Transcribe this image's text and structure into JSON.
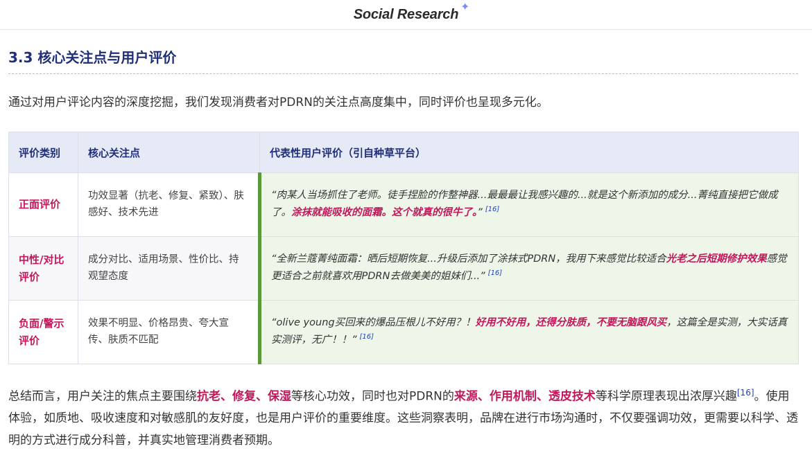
{
  "brand": {
    "name": "Social Research",
    "star": "✦"
  },
  "section": {
    "title": "3.3 核心关注点与用户评价"
  },
  "intro": "通过对用户评论内容的深度挖掘，我们发现消费者对PDRN的关注点高度集中，同时评价也呈现多元化。",
  "table": {
    "headers": [
      "评价类别",
      "核心关注点",
      "代表性用户评价（引自种草平台）"
    ],
    "rows": [
      {
        "category": "正面评价",
        "focus": "功效显著（抗老、修复、紧致）、肤感好、技术先进",
        "quote_plain": "“肉某人当场抓住了老师。徒手捏脸的作整神器...最最最让我感兴趣的...就是这个新添加的成分...菁纯直接把它做成了。",
        "quote_hl": "涂抹就能吸收的面霜。这个就真的很牛了。",
        "quote_end": "”",
        "cite": "[16]"
      },
      {
        "category": "中性/对比评价",
        "focus": "成分对比、适用场景、性价比、持观望态度",
        "quote_plain": "“全新兰蔻菁纯面霜：晒后短期恢复...升级后添加了涂抹式PDRN，我用下来感觉比较适合",
        "quote_hl": "光老之后短期修护效果",
        "quote_end": "感觉更适合之前就喜欢用PDRN去做美美的姐妹们...”",
        "cite": "[16]"
      },
      {
        "category": "负面/警示评价",
        "focus": "效果不明显、价格昂贵、夸大宣传、肤质不匹配",
        "quote_plain": "“olive young买回来的爆品压根儿不好用？！",
        "quote_hl": "好用不好用，还得分肤质，不要无脑跟风买",
        "quote_end": "，这篇全是实测，大实话真实测评，无广！！”",
        "cite": "[16]"
      }
    ]
  },
  "summary": {
    "p1": "总结而言，用户关注的焦点主要围绕",
    "hl1": "抗老、修复、保湿",
    "p2": "等核心功效，同时也对PDRN的",
    "hl2": "来源、作用机制、透皮技术",
    "p3": "等科学原理表现出浓厚兴趣",
    "cite": "[16]",
    "p4": "。使用体验，如质地、吸收速度和对敏感肌的友好度，也是用户评价的重要维度。这些洞察表明，品牌在进行市场沟通时，不仅要强调功效，更需要以科学、透明的方式进行成分科普，并真实地管理消费者预期。"
  }
}
